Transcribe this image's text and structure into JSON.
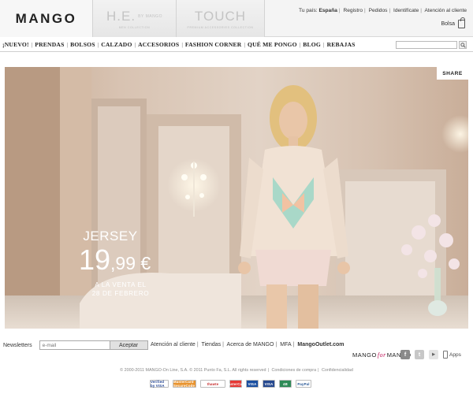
{
  "header": {
    "brands": [
      {
        "logo": "MANGO",
        "sub": ""
      },
      {
        "logo": "H.E.",
        "logo_small": "BY MANGO",
        "sub": "MEN COLLECTION"
      },
      {
        "logo": "TOUCH",
        "sub": "PREMIUM ACCESSORIES COLLECTION"
      }
    ],
    "top_links": {
      "country_label": "Tu país:",
      "country": "España",
      "registro": "Registro",
      "pedidos": "Pedidos",
      "identificate": "Identifícate",
      "atencion": "Atención al cliente"
    },
    "bag_label": "Bolsa",
    "bag_count": "0"
  },
  "nav": {
    "items": [
      "¡NUEVO!",
      "PRENDAS",
      "BOLSOS",
      "CALZADO",
      "ACCESORIOS",
      "FASHION CORNER",
      "QUÉ ME PONGO",
      "BLOG",
      "REBAJAS"
    ],
    "search_placeholder": ""
  },
  "hero": {
    "share_label": "SHARE",
    "promo_title": "JERSEY",
    "price_main": "19",
    "price_cents": ",99 €",
    "promo_line1": "A LA VENTA EL",
    "promo_line2": "28 DE FEBRERO"
  },
  "footer": {
    "newsletter_label": "Newsletters",
    "email_placeholder": "e-mail",
    "accept_label": "Aceptar",
    "links": [
      "Atención al cliente",
      "Tiendas",
      "Acerca de MANGO",
      "MFA",
      "MangoOutlet.com"
    ],
    "m4m_pre": "MANGO",
    "m4m_mid": "for",
    "m4m_post": "MANGO",
    "apps_label": "Apps",
    "copyright": [
      "© 2000-2011 MANGO-On Line, S.A. © 2011 Punto Fa, S.L. All rights reserved",
      "Condiciones de compra",
      "Confidencialidad"
    ],
    "payments": [
      "Verified by VISA",
      "MasterCard SecureCode",
      "thawte",
      "MasterCard",
      "VISA",
      "VISA",
      "4B",
      "PayPal"
    ]
  }
}
